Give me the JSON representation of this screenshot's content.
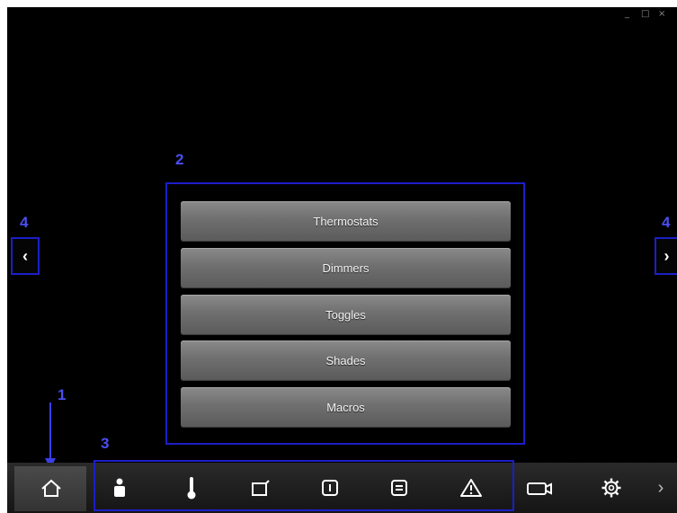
{
  "window_controls": {
    "minimize_symbol": "_",
    "maximize_symbol": "□",
    "close_symbol": "×"
  },
  "annotations": {
    "home_label": "1",
    "menu_label": "2",
    "toolbar_label": "3",
    "left_arrow_label": "4",
    "right_arrow_label": "4"
  },
  "menu": {
    "items": [
      {
        "label": "Thermostats"
      },
      {
        "label": "Dimmers"
      },
      {
        "label": "Toggles"
      },
      {
        "label": "Shades"
      },
      {
        "label": "Macros"
      }
    ]
  },
  "navigation": {
    "left_arrow": "‹",
    "right_arrow": "›"
  },
  "bottom_bar": {
    "more_symbol": "›",
    "icons": [
      "home-icon",
      "person-icon",
      "thermometer-icon",
      "shade-icon",
      "toggle-icon",
      "macro-icon",
      "warning-icon",
      "camera-icon",
      "gear-icon",
      "chevron-right-icon"
    ]
  },
  "colors": {
    "background": "#000000",
    "annotation": "#4a4ff0",
    "annotation_border": "#1c1ec8",
    "button": "#6f6f6f",
    "button_text": "#f2f2f2"
  }
}
